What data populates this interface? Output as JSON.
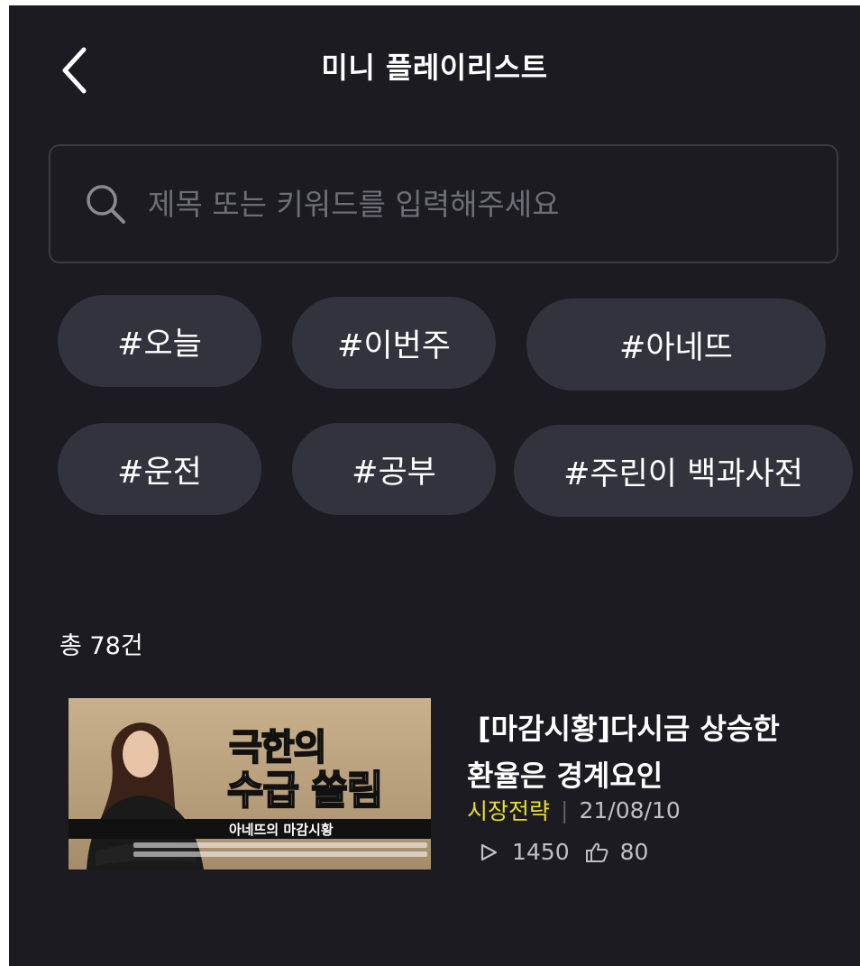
{
  "header": {
    "title": "미니 플레이리스트"
  },
  "search": {
    "placeholder": "제목 또는 키워드를 입력해주세요",
    "value": ""
  },
  "tags": [
    "#오늘",
    "#이번주",
    "#아네뜨",
    "#운전",
    "#공부",
    "#주린이 백과사전"
  ],
  "result_count": "총 78건",
  "video": {
    "title": "[마감시황]다시금 상승한 환율은 경계요인",
    "category": "시장전략",
    "separator": "|",
    "date": "21/08/10",
    "views": "1450",
    "likes": "80",
    "thumbnail": {
      "headline1": "극한의",
      "headline2": "수급 쏠림",
      "caption": "아네뜨의 마감시황"
    }
  },
  "colors": {
    "background": "#1b1b21",
    "tag_bg": "#33333d",
    "accent_category": "#e9dc32",
    "muted_text": "#bfbfc6"
  },
  "icons": [
    "chevron-left-icon",
    "search-icon",
    "play-icon",
    "thumbs-up-icon"
  ]
}
